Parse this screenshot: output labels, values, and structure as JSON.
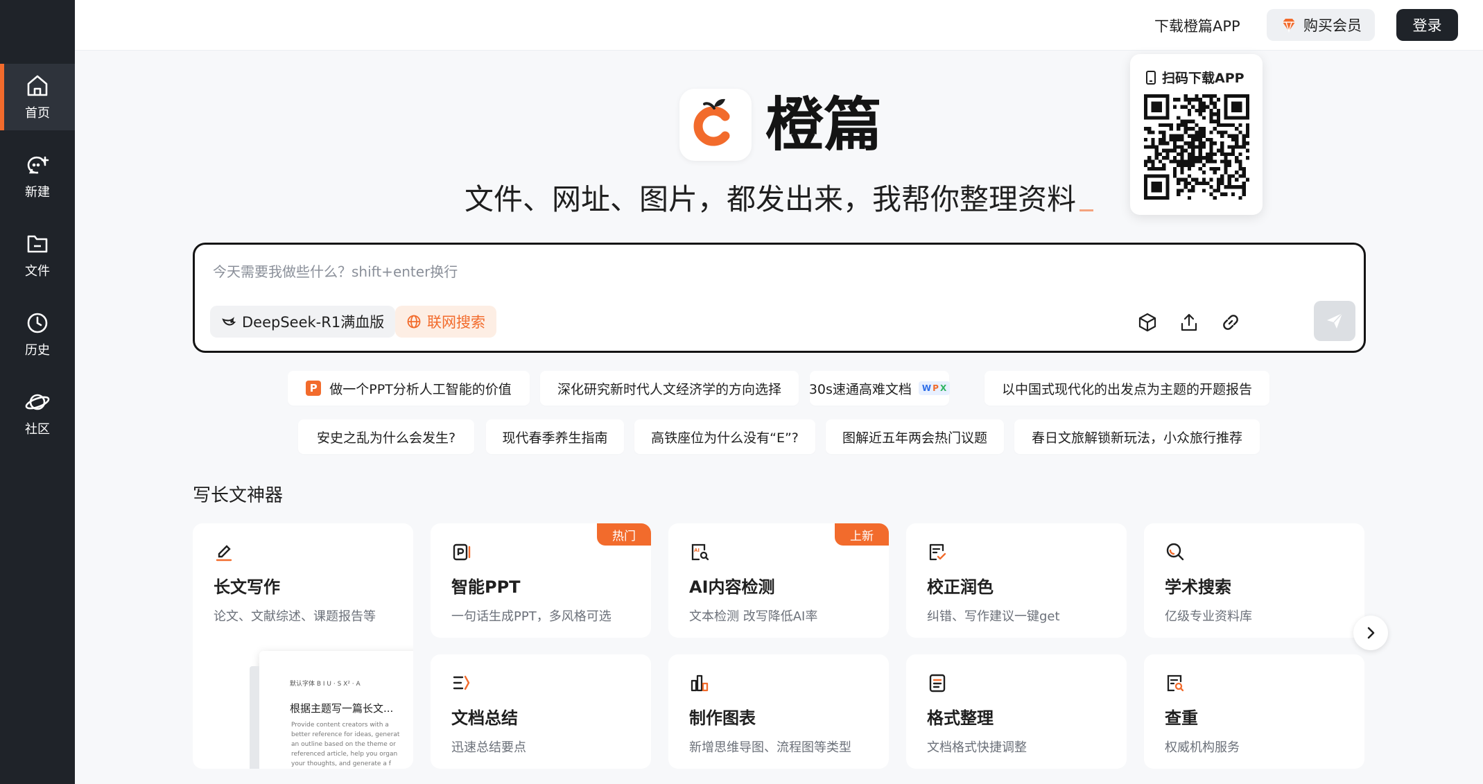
{
  "sidebar": {
    "items": [
      {
        "label": "首页",
        "icon": "home-icon",
        "active": true
      },
      {
        "label": "新建",
        "icon": "new-chat-icon"
      },
      {
        "label": "文件",
        "icon": "folder-icon"
      },
      {
        "label": "历史",
        "icon": "history-clock-icon"
      },
      {
        "label": "社区",
        "icon": "planet-icon"
      }
    ]
  },
  "header": {
    "download_app": "下载橙篇APP",
    "buy_vip": "购买会员",
    "login": "登录"
  },
  "qr": {
    "title": "扫码下载APP"
  },
  "hero": {
    "brand": "橙篇",
    "tagline": "文件、网址、图片，都发出来，我帮你整理资料"
  },
  "input": {
    "placeholder": "今天需要我做些什么？shift+enter换行",
    "model": "DeepSeek-R1满血版",
    "web_search": "联网搜索"
  },
  "suggestions": {
    "row1": [
      "做一个PPT分析人工智能的价值",
      "深化研究新时代人文经济学的方向选择",
      "30s速通高难文档",
      "以中国式现代化的出发点为主题的开题报告"
    ],
    "row2": [
      "安史之乱为什么会发生?",
      "现代春季养生指南",
      "高铁座位为什么没有“E”?",
      "图解近五年两会热门议题",
      "春日文旅解锁新玩法，小众旅行推荐"
    ]
  },
  "section": {
    "title": "写长文神器"
  },
  "cards": [
    {
      "title": "长文写作",
      "desc": "论文、文献综述、课题报告等"
    },
    {
      "title": "智能PPT",
      "desc": "一句话生成PPT，多风格可选",
      "tag": "热门"
    },
    {
      "title": "AI内容检测",
      "desc": "文本检测 改写降低AI率",
      "tag": "上新"
    },
    {
      "title": "校正润色",
      "desc": "纠错、写作建议一键get"
    },
    {
      "title": "学术搜索",
      "desc": "亿级专业资料库"
    },
    {
      "title": "文档总结",
      "desc": "迅速总结要点"
    },
    {
      "title": "制作图表",
      "desc": "新增思维导图、流程图等类型"
    },
    {
      "title": "格式整理",
      "desc": "文档格式快捷调整"
    },
    {
      "title": "查重",
      "desc": "权威机构服务"
    }
  ],
  "preview": {
    "toolbar": "默认字体   B  I  U  ·  S  X²  ·  A",
    "heading": "根据主题写一篇长文...",
    "body": "Provide content creators with a\nbetter reference for ideas, generat\nan outline based on the theme or\nreferenced article, help you organ\nyour thoughts, and generate a f"
  },
  "colors": {
    "accent": "#f26b2c",
    "sidebar_bg": "#1f2329",
    "page_bg": "#f7f8fa"
  }
}
